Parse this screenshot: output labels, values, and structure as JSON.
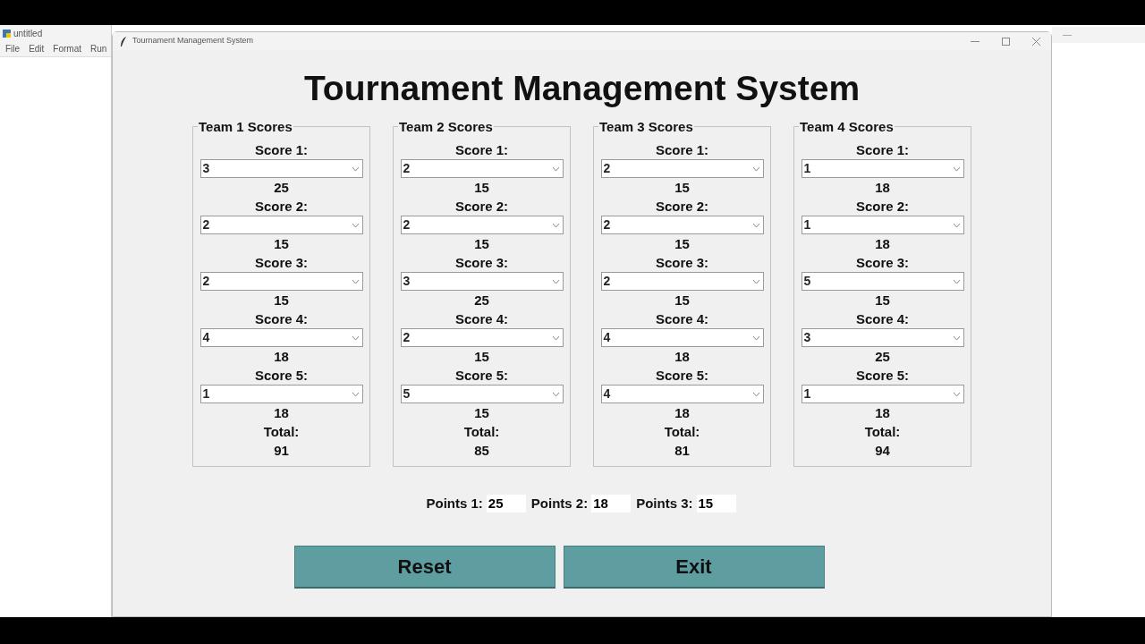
{
  "background_window_left": {
    "title": "untitled",
    "menu": [
      "File",
      "Edit",
      "Format",
      "Run"
    ]
  },
  "window": {
    "title": "Tournament Management System"
  },
  "heading": "Tournament Management System",
  "teams": [
    {
      "title": "Team 1 Scores",
      "scores": [
        {
          "label": "Score 1:",
          "value": "3",
          "points": "25"
        },
        {
          "label": "Score 2:",
          "value": "2",
          "points": "15"
        },
        {
          "label": "Score 3:",
          "value": "2",
          "points": "15"
        },
        {
          "label": "Score 4:",
          "value": "4",
          "points": "18"
        },
        {
          "label": "Score 5:",
          "value": "1",
          "points": "18"
        }
      ],
      "total_label": "Total:",
      "total": "91"
    },
    {
      "title": "Team 2 Scores",
      "scores": [
        {
          "label": "Score 1:",
          "value": "2",
          "points": "15"
        },
        {
          "label": "Score 2:",
          "value": "2",
          "points": "15"
        },
        {
          "label": "Score 3:",
          "value": "3",
          "points": "25"
        },
        {
          "label": "Score 4:",
          "value": "2",
          "points": "15"
        },
        {
          "label": "Score 5:",
          "value": "5",
          "points": "15"
        }
      ],
      "total_label": "Total:",
      "total": "85"
    },
    {
      "title": "Team 3 Scores",
      "scores": [
        {
          "label": "Score 1:",
          "value": "2",
          "points": "15"
        },
        {
          "label": "Score 2:",
          "value": "2",
          "points": "15"
        },
        {
          "label": "Score 3:",
          "value": "2",
          "points": "15"
        },
        {
          "label": "Score 4:",
          "value": "4",
          "points": "18"
        },
        {
          "label": "Score 5:",
          "value": "4",
          "points": "18"
        }
      ],
      "total_label": "Total:",
      "total": "81"
    },
    {
      "title": "Team 4 Scores",
      "scores": [
        {
          "label": "Score 1:",
          "value": "1",
          "points": "18"
        },
        {
          "label": "Score 2:",
          "value": "1",
          "points": "18"
        },
        {
          "label": "Score 3:",
          "value": "5",
          "points": "15"
        },
        {
          "label": "Score 4:",
          "value": "3",
          "points": "25"
        },
        {
          "label": "Score 5:",
          "value": "1",
          "points": "18"
        }
      ],
      "total_label": "Total:",
      "total": "94"
    }
  ],
  "points": [
    {
      "label": "Points 1:",
      "value": "25"
    },
    {
      "label": "Points 2:",
      "value": "18"
    },
    {
      "label": "Points 3:",
      "value": "15"
    }
  ],
  "buttons": [
    "Reset",
    "Exit"
  ]
}
